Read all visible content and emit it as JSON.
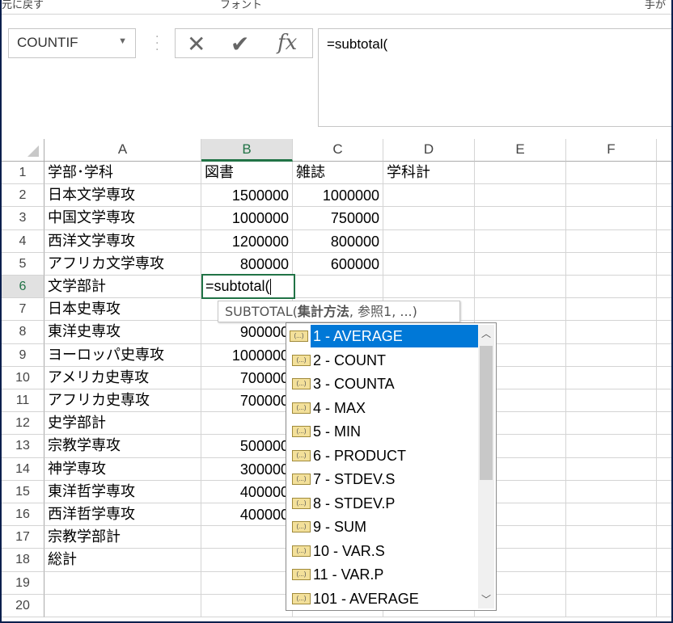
{
  "ribbon": {
    "groups": [
      "元に戻す",
      "フォント",
      "手が"
    ]
  },
  "namebox": {
    "value": "COUNTIF"
  },
  "formula_bar": {
    "cancel": "✕",
    "enter": "✔",
    "fx": "fx",
    "value": "=subtotal("
  },
  "columns": [
    "A",
    "B",
    "C",
    "D",
    "E",
    "F"
  ],
  "selected_column": "B",
  "rows": [
    {
      "n": "1",
      "a": "学部･学科",
      "b": "図書",
      "c": "雑誌",
      "d": "学科計"
    },
    {
      "n": "2",
      "a": "日本文学専攻",
      "b": "1500000",
      "c": "1000000"
    },
    {
      "n": "3",
      "a": "中国文学専攻",
      "b": "1000000",
      "c": "750000"
    },
    {
      "n": "4",
      "a": "西洋文学専攻",
      "b": "1200000",
      "c": "800000"
    },
    {
      "n": "5",
      "a": "アフリカ文学専攻",
      "b": "800000",
      "c": "600000"
    },
    {
      "n": "6",
      "a": "文学部計"
    },
    {
      "n": "7",
      "a": "日本史専攻"
    },
    {
      "n": "8",
      "a": "東洋史専攻",
      "b": "900000"
    },
    {
      "n": "9",
      "a": "ヨーロッパ史専攻",
      "b": "1000000"
    },
    {
      "n": "10",
      "a": "アメリカ史専攻",
      "b": "700000"
    },
    {
      "n": "11",
      "a": "アフリカ史専攻",
      "b": "700000"
    },
    {
      "n": "12",
      "a": "史学部計"
    },
    {
      "n": "13",
      "a": "宗教学専攻",
      "b": "500000"
    },
    {
      "n": "14",
      "a": "神学専攻",
      "b": "300000"
    },
    {
      "n": "15",
      "a": "東洋哲学専攻",
      "b": "400000"
    },
    {
      "n": "16",
      "a": "西洋哲学専攻",
      "b": "400000"
    },
    {
      "n": "17",
      "a": "宗教学部計"
    },
    {
      "n": "18",
      "a": "総計"
    },
    {
      "n": "19"
    },
    {
      "n": "20"
    }
  ],
  "active_cell": {
    "value": "=subtotal("
  },
  "tooltip": {
    "func": "SUBTOTAL(",
    "arg1": "集計方法",
    "rest": ", 参照1, ...)"
  },
  "autocomplete": {
    "items": [
      "1 - AVERAGE",
      "2 - COUNT",
      "3 - COUNTA",
      "4 - MAX",
      "5 - MIN",
      "6 - PRODUCT",
      "7 - STDEV.S",
      "8 - STDEV.P",
      "9 - SUM",
      "10 - VAR.S",
      "11 - VAR.P",
      "101 - AVERAGE"
    ],
    "selected_index": 0
  },
  "colors": {
    "accent": "#217346",
    "selection": "#0078d7",
    "frame": "#0b1f4d"
  }
}
